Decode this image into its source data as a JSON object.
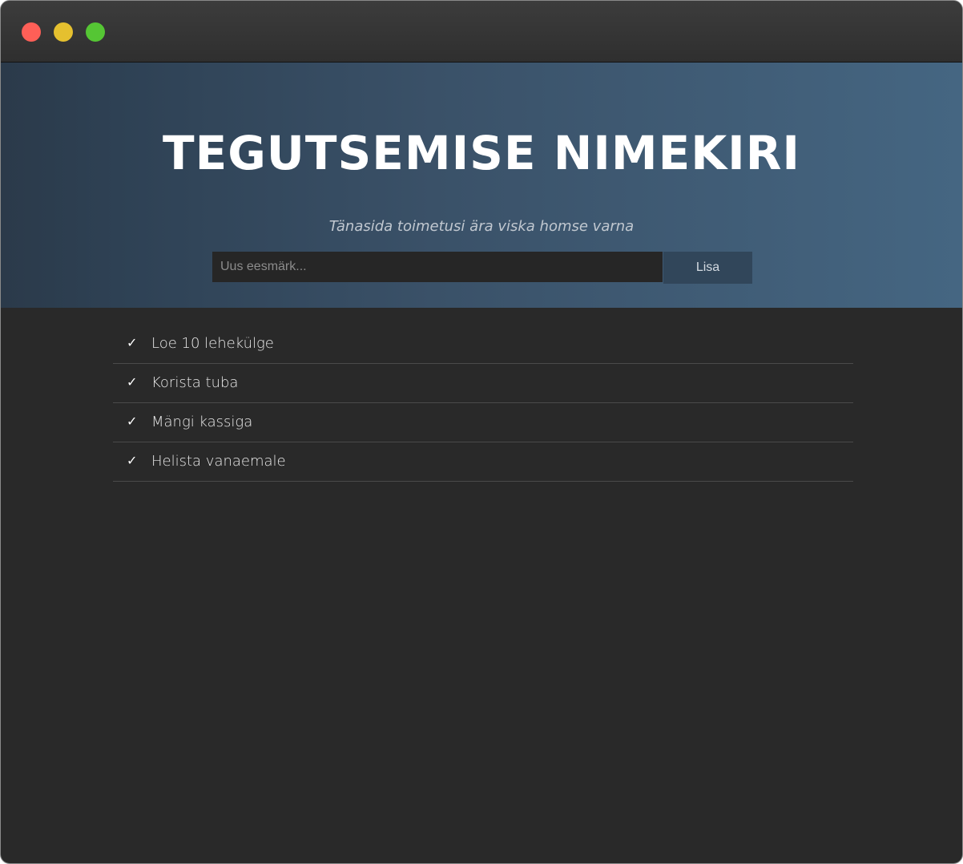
{
  "window": {
    "controls": [
      {
        "name": "close",
        "color": "#fe5f57"
      },
      {
        "name": "minimize",
        "color": "#e5c02f"
      },
      {
        "name": "zoom",
        "color": "#55c634"
      }
    ]
  },
  "header": {
    "title": "TEGUTSEMISE NIMEKIRI",
    "subtitle": "Tänasida toimetusi ära viska homse varna",
    "input_placeholder": "Uus eesmärk...",
    "input_value": "",
    "add_button_label": "Lisa"
  },
  "todos": [
    {
      "label": "Loe 10 lehekülge",
      "icon": "check-icon",
      "check_glyph": "✓"
    },
    {
      "label": "Korista tuba",
      "icon": "check-icon",
      "check_glyph": "✓"
    },
    {
      "label": "Mängi kassiga",
      "icon": "check-icon",
      "check_glyph": "✓"
    },
    {
      "label": "Helista vanaemale",
      "icon": "check-icon",
      "check_glyph": "✓"
    }
  ],
  "colors": {
    "background": "#292929",
    "header_gradient_start": "#2b3a4a",
    "header_gradient_end": "#456682",
    "button": "#31465a"
  }
}
